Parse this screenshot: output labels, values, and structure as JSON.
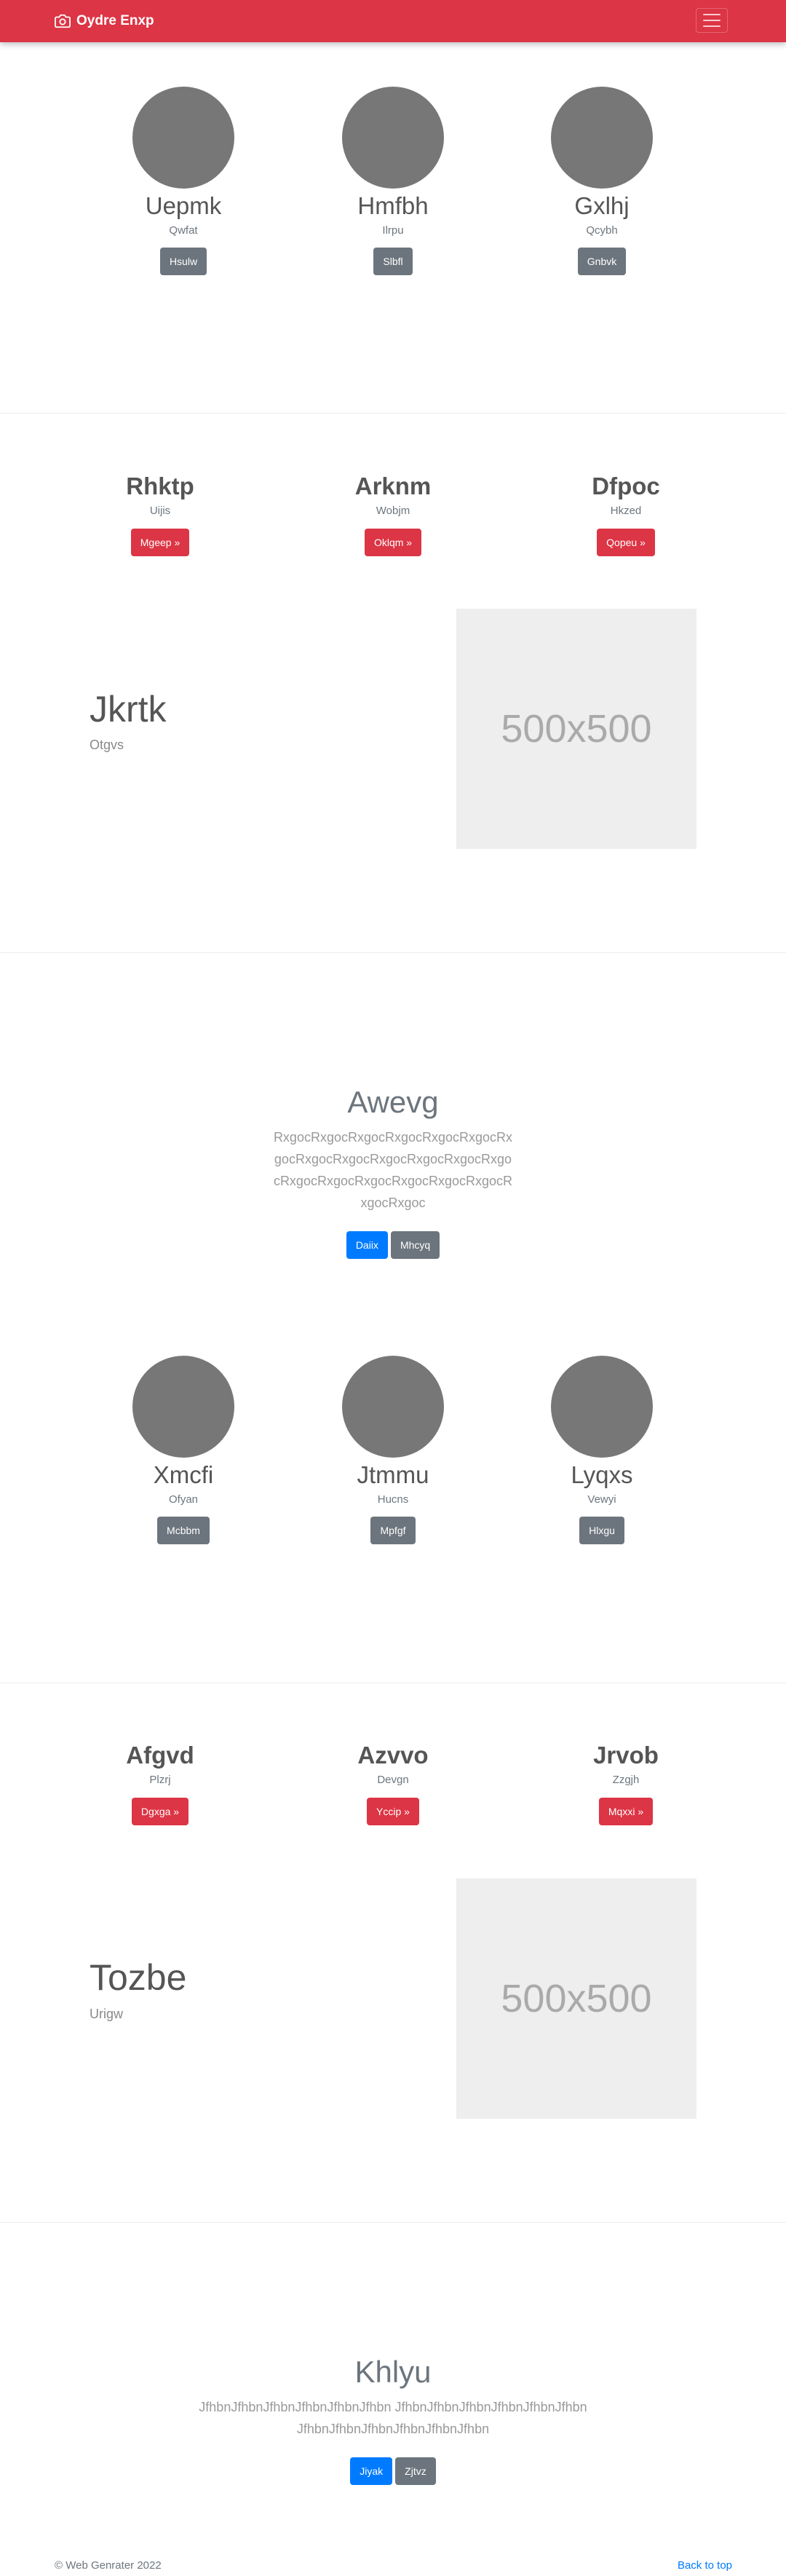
{
  "navbar": {
    "brand": "Oydre Enxp",
    "icon": "camera-icon",
    "toggler_icon": "hamburger-menu-icon",
    "color": "#dc3545"
  },
  "row1": [
    {
      "title": "Uepmk",
      "subtitle": "Qwfat",
      "button": "Hsulw"
    },
    {
      "title": "Hmfbh",
      "subtitle": "Ilrpu",
      "button": "Slbfl"
    },
    {
      "title": "Gxlhj",
      "subtitle": "Qcybh",
      "button": "Gnbvk"
    }
  ],
  "row2": [
    {
      "title": "Rhktp",
      "subtitle": "Uijis",
      "button": "Mgeep »"
    },
    {
      "title": "Arknm",
      "subtitle": "Wobjm",
      "button": "Oklqm »"
    },
    {
      "title": "Dfpoc",
      "subtitle": "Hkzed",
      "button": "Qopeu »"
    }
  ],
  "feature1": {
    "title": "Jkrtk",
    "subtitle": "Otgvs",
    "image_text": "500x500"
  },
  "jumbo1": {
    "title": "Awevg",
    "lead": "RxgocRxgocRxgocRxgocRxgocRxgocRxgocRxgocRxgocRxgocRxgocRxgocRxgocRxgocRxgocRxgocRxgocRxgocRxgocRxgocRxgoc",
    "primary": "Daiix",
    "secondary": "Mhcyq"
  },
  "row3": [
    {
      "title": "Xmcfi",
      "subtitle": "Ofyan",
      "button": "Mcbbm"
    },
    {
      "title": "Jtmmu",
      "subtitle": "Hucns",
      "button": "Mpfgf"
    },
    {
      "title": "Lyqxs",
      "subtitle": "Vewyi",
      "button": "Hlxgu"
    }
  ],
  "row4": [
    {
      "title": "Afgvd",
      "subtitle": "Plzrj",
      "button": "Dgxga »"
    },
    {
      "title": "Azvvo",
      "subtitle": "Devgn",
      "button": "Yccip »"
    },
    {
      "title": "Jrvob",
      "subtitle": "Zzgjh",
      "button": "Mqxxi »"
    }
  ],
  "feature2": {
    "title": "Tozbe",
    "subtitle": "Urigw",
    "image_text": "500x500"
  },
  "jumbo2": {
    "title": "Khlyu",
    "lead_line1": "JfhbnJfhbnJfhbnJfhbnJfhbnJfhbn JfhbnJfhbnJfhbnJfhbnJfhbnJfhbn",
    "lead_line2": "JfhbnJfhbnJfhbnJfhbnJfhbnJfhbn",
    "primary": "Jiyak",
    "secondary": "Zjtvz"
  },
  "footer": {
    "copyright": "© Web Genrater 2022",
    "back_to_top": "Back to top"
  }
}
